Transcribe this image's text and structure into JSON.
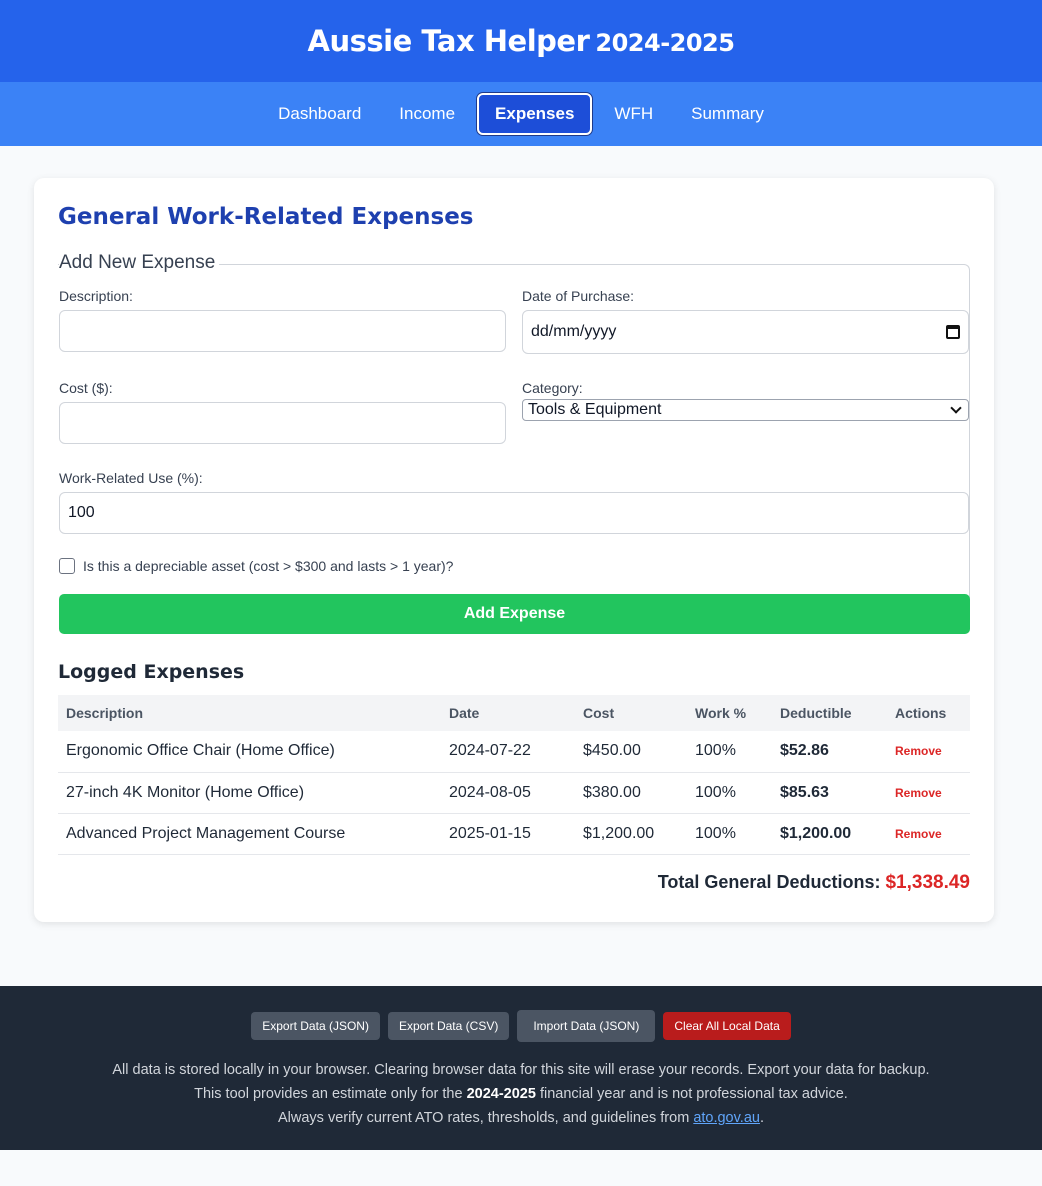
{
  "header": {
    "title": "Aussie Tax Helper",
    "year": "2024-2025"
  },
  "nav": {
    "tabs": [
      {
        "label": "Dashboard"
      },
      {
        "label": "Income"
      },
      {
        "label": "Expenses"
      },
      {
        "label": "WFH"
      },
      {
        "label": "Summary"
      }
    ],
    "active": "Expenses"
  },
  "expenses": {
    "title": "General Work-Related Expenses",
    "form": {
      "legend": "Add New Expense",
      "description_label": "Description:",
      "description_value": "",
      "date_label": "Date of Purchase:",
      "date_placeholder": "dd/mm/yyyy",
      "cost_label": "Cost ($):",
      "cost_value": "",
      "category_label": "Category:",
      "category_value": "Tools & Equipment",
      "work_use_label": "Work-Related Use (%):",
      "work_use_value": "100",
      "depreciable_label": "Is this a depreciable asset (cost > $300 and lasts > 1 year)?",
      "add_button": "Add Expense"
    },
    "logged_title": "Logged Expenses",
    "table": {
      "columns": [
        "Description",
        "Date",
        "Cost",
        "Work %",
        "Deductible",
        "Actions"
      ],
      "rows": [
        {
          "description": "Ergonomic Office Chair (Home Office)",
          "date": "2024-07-22",
          "cost": "$450.00",
          "work": "100%",
          "deductible": "$52.86",
          "action": "Remove"
        },
        {
          "description": "27-inch 4K Monitor (Home Office)",
          "date": "2024-08-05",
          "cost": "$380.00",
          "work": "100%",
          "deductible": "$85.63",
          "action": "Remove"
        },
        {
          "description": "Advanced Project Management Course",
          "date": "2025-01-15",
          "cost": "$1,200.00",
          "work": "100%",
          "deductible": "$1,200.00",
          "action": "Remove"
        }
      ]
    },
    "total_label": "Total General Deductions:",
    "total_value": "$1,338.49"
  },
  "footer": {
    "buttons": {
      "export_json": "Export Data (JSON)",
      "export_csv": "Export Data (CSV)",
      "import_json": "Import Data (JSON)",
      "clear": "Clear All Local Data"
    },
    "line1": "All data is stored locally in your browser. Clearing browser data for this site will erase your records. Export your data for backup.",
    "line2_pre": "This tool provides an estimate only for the",
    "line2_year": "2024-2025",
    "line2_post": "financial year and is not professional tax advice.",
    "line3_pre": "Always verify current ATO rates, thresholds, and guidelines from",
    "line3_link": "ato.gov.au",
    "line3_post": "."
  },
  "colors": {
    "header_bg": "#2563eb",
    "nav_bg": "#3b82f6",
    "title_blue": "#1e40af",
    "add_green": "#22c55e",
    "danger_red": "#dc2626",
    "footer_bg": "#1f2937"
  }
}
